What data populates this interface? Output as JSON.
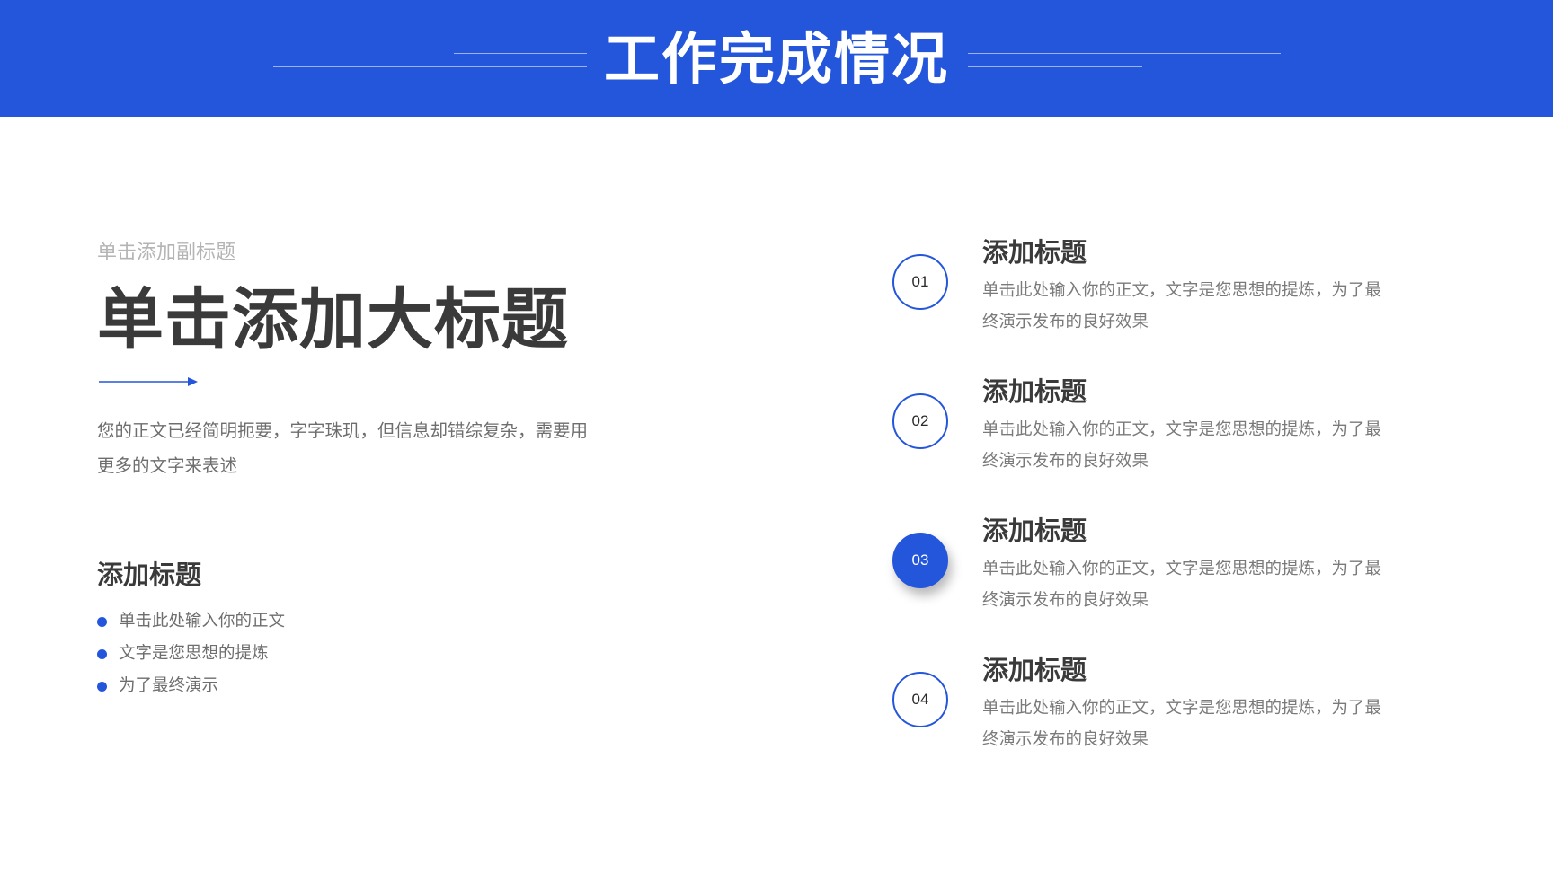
{
  "header": {
    "title": "工作完成情况"
  },
  "hero": {
    "subtitle": "单击添加副标题",
    "title": "单击添加大标题",
    "body": "您的正文已经简明扼要，字字珠玑，但信息却错综复杂，需要用更多的文字来表述"
  },
  "left_section": {
    "title": "添加标题",
    "bullets": [
      "单击此处输入你的正文",
      "文字是您思想的提炼",
      "为了最终演示"
    ]
  },
  "items": [
    {
      "number": "01",
      "title": "添加标题",
      "desc": "单击此处输入你的正文，文字是您思想的提炼，为了最终演示发布的良好效果"
    },
    {
      "number": "02",
      "title": "添加标题",
      "desc": "单击此处输入你的正文，文字是您思想的提炼，为了最终演示发布的良好效果"
    },
    {
      "number": "03",
      "title": "添加标题",
      "desc": "单击此处输入你的正文，文字是您思想的提炼，为了最终演示发布的良好效果"
    },
    {
      "number": "04",
      "title": "添加标题",
      "desc": "单击此处输入你的正文，文字是您思想的提炼，为了最终演示发布的良好效果"
    }
  ],
  "active_item": "03",
  "colors": {
    "accent": "#2456dc",
    "heading": "#3a3a3a",
    "body": "#6e6e6e",
    "subtitle": "#b4b4b4"
  }
}
